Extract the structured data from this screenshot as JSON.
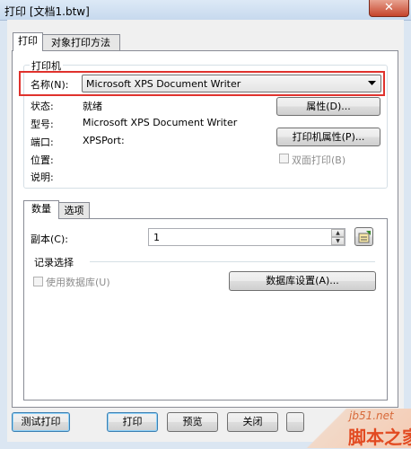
{
  "window": {
    "title": "打印 [文档1.btw]",
    "close_icon": "✕"
  },
  "tabs": {
    "print": "打印",
    "object_print": "对象打印方法"
  },
  "printer_group": {
    "legend": "打印机",
    "name_label": "名称(N):",
    "name_value": "Microsoft XPS Document Writer",
    "status_label": "状态:",
    "status_value": "就绪",
    "type_label": "型号:",
    "type_value": "Microsoft XPS Document Writer",
    "port_label": "端口:",
    "port_value": "XPSPort:",
    "location_label": "位置:",
    "comment_label": "说明:",
    "properties_button": "属性(D)...",
    "printer_properties_button": "打印机属性(P)...",
    "duplex_label": "双面打印(B)"
  },
  "inner_tabs": {
    "quantity": "数量",
    "options": "选项"
  },
  "quantity": {
    "copies_label": "副本(C):",
    "copies_value": "1",
    "records_legend": "记录选择",
    "use_database_label": "使用数据库(U)",
    "database_settings_button": "数据库设置(A)..."
  },
  "buttons": {
    "test_print": "测试打印",
    "print": "打印",
    "preview": "预览",
    "close": "关闭"
  },
  "watermark": {
    "site": "jb51.net",
    "brand": "脚本之家"
  }
}
